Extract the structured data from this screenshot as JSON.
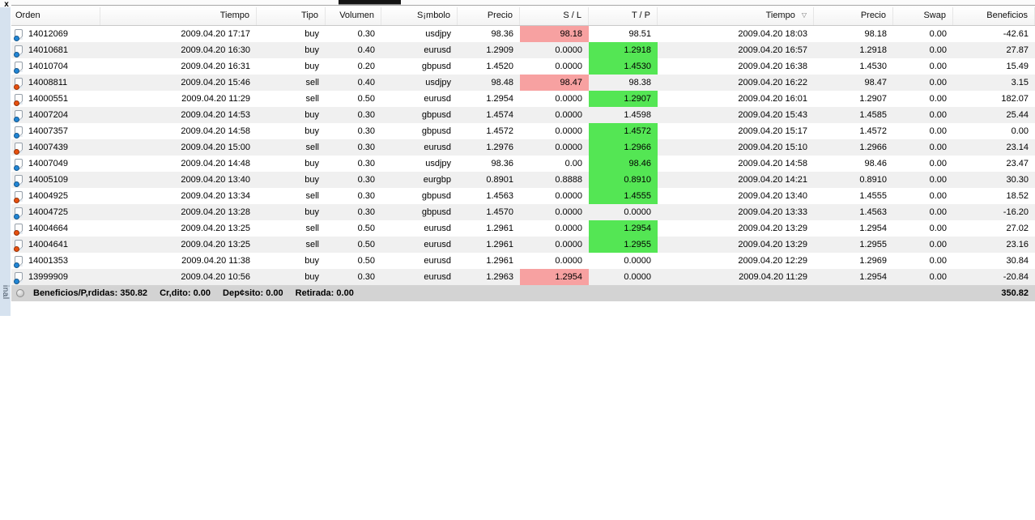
{
  "window": {
    "close_label": "x",
    "vertical_tab_label": "inal"
  },
  "colors": {
    "buy_dot": "#2186d6",
    "sell_dot": "#e8500e",
    "sl_highlight": "#f7a1a1",
    "tp_highlight": "#54e654",
    "summary_bg": "#d3d3d3",
    "alt_row_bg": "#f0f0f0",
    "left_strip_bg": "#d6e2ef"
  },
  "columns": [
    {
      "label": "Orden"
    },
    {
      "label": "Tiempo"
    },
    {
      "label": "Tipo"
    },
    {
      "label": "Volumen"
    },
    {
      "label": "S¡mbolo"
    },
    {
      "label": "Precio"
    },
    {
      "label": "S / L"
    },
    {
      "label": "T / P"
    },
    {
      "label": "Tiempo",
      "sort_indicator": "▽"
    },
    {
      "label": "Precio"
    },
    {
      "label": "Swap"
    },
    {
      "label": "Beneficios"
    }
  ],
  "rows": [
    {
      "order": "14012069",
      "open_time": "2009.04.20 17:17",
      "type": "buy",
      "volume": "0.30",
      "symbol": "usdjpy",
      "open_price": "98.36",
      "sl": "98.18",
      "tp": "98.51",
      "close_time": "2009.04.20 18:03",
      "close_price": "98.18",
      "swap": "0.00",
      "profit": "-42.61",
      "sl_hit": true,
      "tp_hit": false
    },
    {
      "order": "14010681",
      "open_time": "2009.04.20 16:30",
      "type": "buy",
      "volume": "0.40",
      "symbol": "eurusd",
      "open_price": "1.2909",
      "sl": "0.0000",
      "tp": "1.2918",
      "close_time": "2009.04.20 16:57",
      "close_price": "1.2918",
      "swap": "0.00",
      "profit": "27.87",
      "sl_hit": false,
      "tp_hit": true
    },
    {
      "order": "14010704",
      "open_time": "2009.04.20 16:31",
      "type": "buy",
      "volume": "0.20",
      "symbol": "gbpusd",
      "open_price": "1.4520",
      "sl": "0.0000",
      "tp": "1.4530",
      "close_time": "2009.04.20 16:38",
      "close_price": "1.4530",
      "swap": "0.00",
      "profit": "15.49",
      "sl_hit": false,
      "tp_hit": true
    },
    {
      "order": "14008811",
      "open_time": "2009.04.20 15:46",
      "type": "sell",
      "volume": "0.40",
      "symbol": "usdjpy",
      "open_price": "98.48",
      "sl": "98.47",
      "tp": "98.38",
      "close_time": "2009.04.20 16:22",
      "close_price": "98.47",
      "swap": "0.00",
      "profit": "3.15",
      "sl_hit": true,
      "tp_hit": false
    },
    {
      "order": "14000551",
      "open_time": "2009.04.20 11:29",
      "type": "sell",
      "volume": "0.50",
      "symbol": "eurusd",
      "open_price": "1.2954",
      "sl": "0.0000",
      "tp": "1.2907",
      "close_time": "2009.04.20 16:01",
      "close_price": "1.2907",
      "swap": "0.00",
      "profit": "182.07",
      "sl_hit": false,
      "tp_hit": true
    },
    {
      "order": "14007204",
      "open_time": "2009.04.20 14:53",
      "type": "buy",
      "volume": "0.30",
      "symbol": "gbpusd",
      "open_price": "1.4574",
      "sl": "0.0000",
      "tp": "1.4598",
      "close_time": "2009.04.20 15:43",
      "close_price": "1.4585",
      "swap": "0.00",
      "profit": "25.44",
      "sl_hit": false,
      "tp_hit": false
    },
    {
      "order": "14007357",
      "open_time": "2009.04.20 14:58",
      "type": "buy",
      "volume": "0.30",
      "symbol": "gbpusd",
      "open_price": "1.4572",
      "sl": "0.0000",
      "tp": "1.4572",
      "close_time": "2009.04.20 15:17",
      "close_price": "1.4572",
      "swap": "0.00",
      "profit": "0.00",
      "sl_hit": false,
      "tp_hit": true
    },
    {
      "order": "14007439",
      "open_time": "2009.04.20 15:00",
      "type": "sell",
      "volume": "0.30",
      "symbol": "eurusd",
      "open_price": "1.2976",
      "sl": "0.0000",
      "tp": "1.2966",
      "close_time": "2009.04.20 15:10",
      "close_price": "1.2966",
      "swap": "0.00",
      "profit": "23.14",
      "sl_hit": false,
      "tp_hit": true
    },
    {
      "order": "14007049",
      "open_time": "2009.04.20 14:48",
      "type": "buy",
      "volume": "0.30",
      "symbol": "usdjpy",
      "open_price": "98.36",
      "sl": "0.00",
      "tp": "98.46",
      "close_time": "2009.04.20 14:58",
      "close_price": "98.46",
      "swap": "0.00",
      "profit": "23.47",
      "sl_hit": false,
      "tp_hit": true
    },
    {
      "order": "14005109",
      "open_time": "2009.04.20 13:40",
      "type": "buy",
      "volume": "0.30",
      "symbol": "eurgbp",
      "open_price": "0.8901",
      "sl": "0.8888",
      "tp": "0.8910",
      "close_time": "2009.04.20 14:21",
      "close_price": "0.8910",
      "swap": "0.00",
      "profit": "30.30",
      "sl_hit": false,
      "tp_hit": true
    },
    {
      "order": "14004925",
      "open_time": "2009.04.20 13:34",
      "type": "sell",
      "volume": "0.30",
      "symbol": "gbpusd",
      "open_price": "1.4563",
      "sl": "0.0000",
      "tp": "1.4555",
      "close_time": "2009.04.20 13:40",
      "close_price": "1.4555",
      "swap": "0.00",
      "profit": "18.52",
      "sl_hit": false,
      "tp_hit": true
    },
    {
      "order": "14004725",
      "open_time": "2009.04.20 13:28",
      "type": "buy",
      "volume": "0.30",
      "symbol": "gbpusd",
      "open_price": "1.4570",
      "sl": "0.0000",
      "tp": "0.0000",
      "close_time": "2009.04.20 13:33",
      "close_price": "1.4563",
      "swap": "0.00",
      "profit": "-16.20",
      "sl_hit": false,
      "tp_hit": false
    },
    {
      "order": "14004664",
      "open_time": "2009.04.20 13:25",
      "type": "sell",
      "volume": "0.50",
      "symbol": "eurusd",
      "open_price": "1.2961",
      "sl": "0.0000",
      "tp": "1.2954",
      "close_time": "2009.04.20 13:29",
      "close_price": "1.2954",
      "swap": "0.00",
      "profit": "27.02",
      "sl_hit": false,
      "tp_hit": true
    },
    {
      "order": "14004641",
      "open_time": "2009.04.20 13:25",
      "type": "sell",
      "volume": "0.50",
      "symbol": "eurusd",
      "open_price": "1.2961",
      "sl": "0.0000",
      "tp": "1.2955",
      "close_time": "2009.04.20 13:29",
      "close_price": "1.2955",
      "swap": "0.00",
      "profit": "23.16",
      "sl_hit": false,
      "tp_hit": true
    },
    {
      "order": "14001353",
      "open_time": "2009.04.20 11:38",
      "type": "buy",
      "volume": "0.50",
      "symbol": "eurusd",
      "open_price": "1.2961",
      "sl": "0.0000",
      "tp": "0.0000",
      "close_time": "2009.04.20 12:29",
      "close_price": "1.2969",
      "swap": "0.00",
      "profit": "30.84",
      "sl_hit": false,
      "tp_hit": false
    },
    {
      "order": "13999909",
      "open_time": "2009.04.20 10:56",
      "type": "buy",
      "volume": "0.30",
      "symbol": "eurusd",
      "open_price": "1.2963",
      "sl": "1.2954",
      "tp": "0.0000",
      "close_time": "2009.04.20 11:29",
      "close_price": "1.2954",
      "swap": "0.00",
      "profit": "-20.84",
      "sl_hit": true,
      "tp_hit": false
    }
  ],
  "summary": {
    "items": [
      {
        "label": "Beneficios/P,rdidas:",
        "value": "350.82"
      },
      {
        "label": "Cr,dito:",
        "value": "0.00"
      },
      {
        "label": "Dep¢sito:",
        "value": "0.00"
      },
      {
        "label": "Retirada:",
        "value": "0.00"
      }
    ],
    "total": "350.82"
  }
}
